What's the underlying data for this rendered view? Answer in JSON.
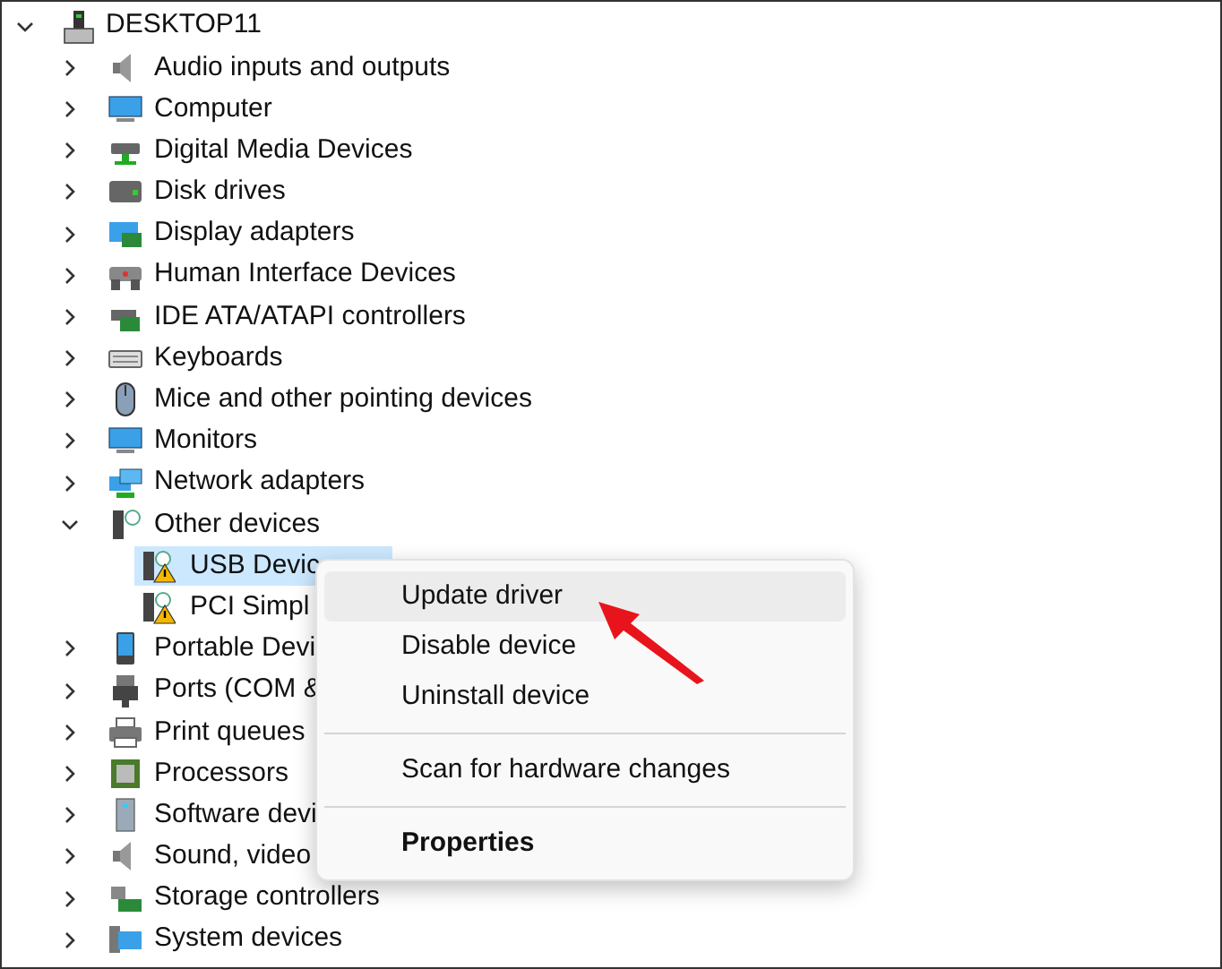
{
  "tree": {
    "label": "DESKTOP11",
    "expanded": true,
    "children": [
      {
        "label": "Audio inputs and outputs",
        "expanded": false,
        "selected": false
      },
      {
        "label": "Computer",
        "expanded": false,
        "selected": false
      },
      {
        "label": "Digital Media Devices",
        "expanded": false,
        "selected": false
      },
      {
        "label": "Disk drives",
        "expanded": false,
        "selected": false
      },
      {
        "label": "Display adapters",
        "expanded": false,
        "selected": false
      },
      {
        "label": "Human Interface Devices",
        "expanded": false,
        "selected": false
      },
      {
        "label": "IDE ATA/ATAPI controllers",
        "expanded": false,
        "selected": false
      },
      {
        "label": "Keyboards",
        "expanded": false,
        "selected": false
      },
      {
        "label": "Mice and other pointing devices",
        "expanded": false,
        "selected": false
      },
      {
        "label": "Monitors",
        "expanded": false,
        "selected": false
      },
      {
        "label": "Network adapters",
        "expanded": false,
        "selected": false
      },
      {
        "label": "Other devices",
        "expanded": true,
        "selected": false,
        "children": [
          {
            "label": "USB Devic",
            "selected": true,
            "warning": true
          },
          {
            "label": "PCI Simpl",
            "selected": false,
            "warning": true
          }
        ]
      },
      {
        "label": "Portable Devi",
        "expanded": false,
        "selected": false
      },
      {
        "label": "Ports (COM &",
        "expanded": false,
        "selected": false
      },
      {
        "label": "Print queues",
        "expanded": false,
        "selected": false
      },
      {
        "label": "Processors",
        "expanded": false,
        "selected": false
      },
      {
        "label": "Software devi",
        "expanded": false,
        "selected": false
      },
      {
        "label": "Sound, video",
        "expanded": false,
        "selected": false
      },
      {
        "label": "Storage controllers",
        "expanded": false,
        "selected": false
      },
      {
        "label": "System devices",
        "expanded": false,
        "selected": false
      }
    ]
  },
  "context_menu": {
    "items": [
      {
        "kind": "item",
        "label": "Update driver",
        "highlighted": true,
        "bold": false
      },
      {
        "kind": "item",
        "label": "Disable device",
        "highlighted": false,
        "bold": false
      },
      {
        "kind": "item",
        "label": "Uninstall device",
        "highlighted": false,
        "bold": false
      },
      {
        "kind": "separator"
      },
      {
        "kind": "item",
        "label": "Scan for hardware changes",
        "highlighted": false,
        "bold": false
      },
      {
        "kind": "separator"
      },
      {
        "kind": "item",
        "label": "Properties",
        "highlighted": false,
        "bold": true
      }
    ]
  }
}
